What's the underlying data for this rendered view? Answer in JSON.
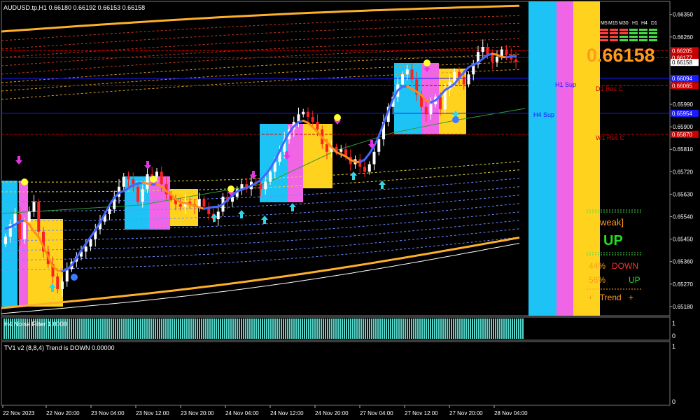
{
  "header": {
    "symbol_info": "AUDUSD.tp,H1  0.66180 0.66192 0.66153 0.66158"
  },
  "price_axis": {
    "ticks": [
      "0.66350",
      "0.66260",
      "0.66158",
      "0.66080",
      "0.65990",
      "0.65900",
      "0.65810",
      "0.65720",
      "0.65630",
      "0.65540",
      "0.65450",
      "0.65360",
      "0.65270",
      "0.65180"
    ],
    "range": [
      0.6516,
      0.6638
    ],
    "labels": [
      {
        "text": "0.66205",
        "value": 0.66205,
        "color": "#cc0000"
      },
      {
        "text": "0.66177",
        "value": 0.66177,
        "color": "#cc0000"
      },
      {
        "text": "0.66158",
        "value": 0.66158,
        "color": "#ffffff"
      },
      {
        "text": "0.66094",
        "value": 0.66094,
        "color": "#1a1aff"
      },
      {
        "text": "0.66065",
        "value": 0.66065,
        "color": "#cc0000"
      },
      {
        "text": "0.65954",
        "value": 0.65954,
        "color": "#1a1aff"
      },
      {
        "text": "0.65870",
        "value": 0.6587,
        "color": "#cc0000"
      }
    ]
  },
  "levels": [
    {
      "label": "H1 Sup",
      "value": 0.6608,
      "color": "#1a1aff"
    },
    {
      "label": "D1 Res C",
      "value": 0.6606,
      "color": "#cc0000"
    },
    {
      "label": "H4 Sup",
      "value": 0.65954,
      "color": "#1a1aff"
    },
    {
      "label": "W1 Res C",
      "value": 0.6587,
      "color": "#cc0000"
    }
  ],
  "big_price": "0.66158",
  "timeframes": [
    "M5",
    "M15",
    "M30",
    "H1",
    "H4",
    "D1"
  ],
  "panel": {
    "strength": "weak]",
    "direction": "UP",
    "down_pct": "44%",
    "down_label": "DOWN",
    "up_pct": "56%",
    "up_label": "UP",
    "trend": "+   Trend   +"
  },
  "sub1": {
    "label": "H4 Noise Filter 1.0000",
    "ticks": [
      "1",
      "0"
    ]
  },
  "sub2": {
    "label": "TV1 v2 (8,8,4) Trend is DOWN 0.00000",
    "ticks": [
      "1",
      "0"
    ]
  },
  "time_axis": [
    "22 Nov 2023",
    "22 Nov 20:00",
    "23 Nov 04:00",
    "23 Nov 12:00",
    "23 Nov 20:00",
    "24 Nov 04:00",
    "24 Nov 12:00",
    "24 Nov 20:00",
    "27 Nov 04:00",
    "27 Nov 12:00",
    "27 Nov 20:00",
    "28 Nov 04:00"
  ],
  "colors": {
    "background": "#000000",
    "bull": "#ffffff",
    "bear": "#ff2020",
    "cyan": "#1ec3f5",
    "pink": "#f064e6",
    "yellow": "#ffd21e",
    "ma_blue": "#4466ff",
    "ma_orange": "#ff8c1a",
    "histogram": "#55d5c8",
    "up_arrow": "#33d6e6",
    "down_arrow": "#e633e6"
  },
  "chart_data": {
    "type": "candlestick",
    "symbol": "AUDUSD.tp",
    "timeframe": "H1",
    "ylim": [
      0.6516,
      0.6638
    ],
    "close": [
      0.6546,
      0.6551,
      0.6555,
      0.6545,
      0.6552,
      0.6556,
      0.656,
      0.6548,
      0.654,
      0.6535,
      0.653,
      0.6525,
      0.6528,
      0.6533,
      0.6536,
      0.6538,
      0.654,
      0.6542,
      0.6545,
      0.6549,
      0.6552,
      0.6555,
      0.6557,
      0.6562,
      0.6566,
      0.657,
      0.6569,
      0.6566,
      0.656,
      0.6565,
      0.6571,
      0.657,
      0.6572,
      0.6567,
      0.6563,
      0.6561,
      0.6559,
      0.6558,
      0.656,
      0.6559,
      0.6558,
      0.6561,
      0.6558,
      0.6555,
      0.6553,
      0.6556,
      0.6562,
      0.656,
      0.6562,
      0.6565,
      0.6567,
      0.6565,
      0.6568,
      0.6567,
      0.6565,
      0.6568,
      0.6572,
      0.6576,
      0.658,
      0.6585,
      0.6589,
      0.6592,
      0.6595,
      0.6596,
      0.6594,
      0.6592,
      0.6589,
      0.6583,
      0.658,
      0.6582,
      0.658,
      0.6581,
      0.6578,
      0.6575,
      0.6577,
      0.6574,
      0.6572,
      0.6575,
      0.658,
      0.6585,
      0.6592,
      0.6598,
      0.6602,
      0.6607,
      0.6611,
      0.6613,
      0.6609,
      0.6603,
      0.6598,
      0.6595,
      0.6599,
      0.6602,
      0.6597,
      0.6605,
      0.6608,
      0.6612,
      0.661,
      0.6607,
      0.6611,
      0.6615,
      0.662,
      0.6622,
      0.6619,
      0.6616,
      0.6618,
      0.6621,
      0.6619,
      0.6617,
      0.6616
    ],
    "indicators": [
      "moving average (blue/orange)",
      "envelope bands",
      "support/resistance levels"
    ]
  }
}
